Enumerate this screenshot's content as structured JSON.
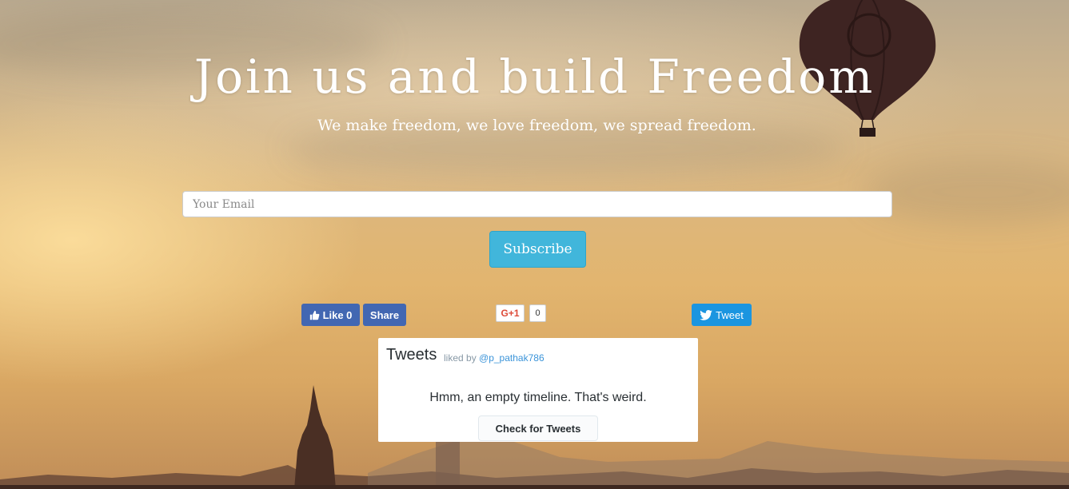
{
  "hero": {
    "title": "Join us and build Freedom",
    "subtitle": "We make freedom, we love freedom, we spread freedom."
  },
  "subscribe_form": {
    "email_placeholder": "Your Email",
    "email_value": "",
    "subscribe_label": "Subscribe"
  },
  "social": {
    "facebook": {
      "like_label": "Like 0",
      "share_label": "Share",
      "color": "#4267b2"
    },
    "google_plus": {
      "label": "G+1",
      "count": "0",
      "color": "#dd4b39"
    },
    "twitter": {
      "tweet_label": "Tweet",
      "color": "#1b95e0"
    }
  },
  "timeline": {
    "title": "Tweets",
    "liked_by_prefix": "liked by",
    "liked_by_user": "@p_pathak786",
    "empty_message": "Hmm, an empty timeline. That's weird.",
    "check_button_label": "Check for Tweets"
  },
  "colors": {
    "accent_button": "#41b6db"
  }
}
